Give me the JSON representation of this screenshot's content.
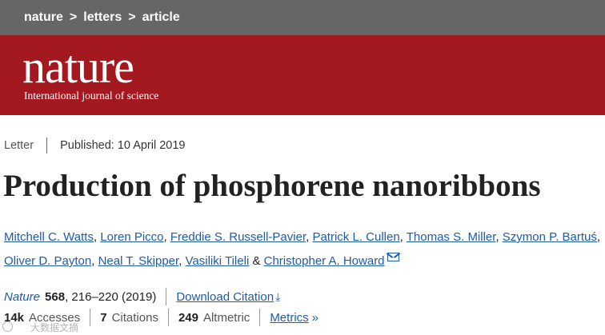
{
  "breadcrumb": [
    "nature",
    "letters",
    "article"
  ],
  "masthead": {
    "logo": "nature",
    "tagline": "International journal of science",
    "bg_color": "#A4181F"
  },
  "meta": {
    "article_type": "Letter",
    "published": "Published: 10 April 2019"
  },
  "title": "Production of phosphorene nanoribbons",
  "authors": [
    "Mitchell C. Watts",
    "Loren Picco",
    "Freddie S. Russell-Pavier",
    "Patrick L. Cullen",
    "Thomas S. Miller",
    "Szymon P. Bartuś",
    "Oliver D. Payton",
    "Neal T. Skipper",
    "Vasiliki Tileli",
    "Christopher A. Howard"
  ],
  "citation": {
    "journal": "Nature",
    "volume": "568",
    "pages": ", 216–220 (2019)",
    "download": "Download Citation"
  },
  "metrics": {
    "accesses_count": "14k",
    "accesses_label": "Accesses",
    "citations_count": "7",
    "citations_label": "Citations",
    "altmetric_count": "249",
    "altmetric_label": "Altmetric",
    "metrics_link": "Metrics"
  },
  "watermark": "大数据文摘",
  "icons": {
    "email": "mail-icon",
    "download": "download-arrow-icon",
    "metrics": "double-chevron-right-icon"
  },
  "colors": {
    "link": "#1f5ba8",
    "breadcrumb_bar": "#666666"
  }
}
